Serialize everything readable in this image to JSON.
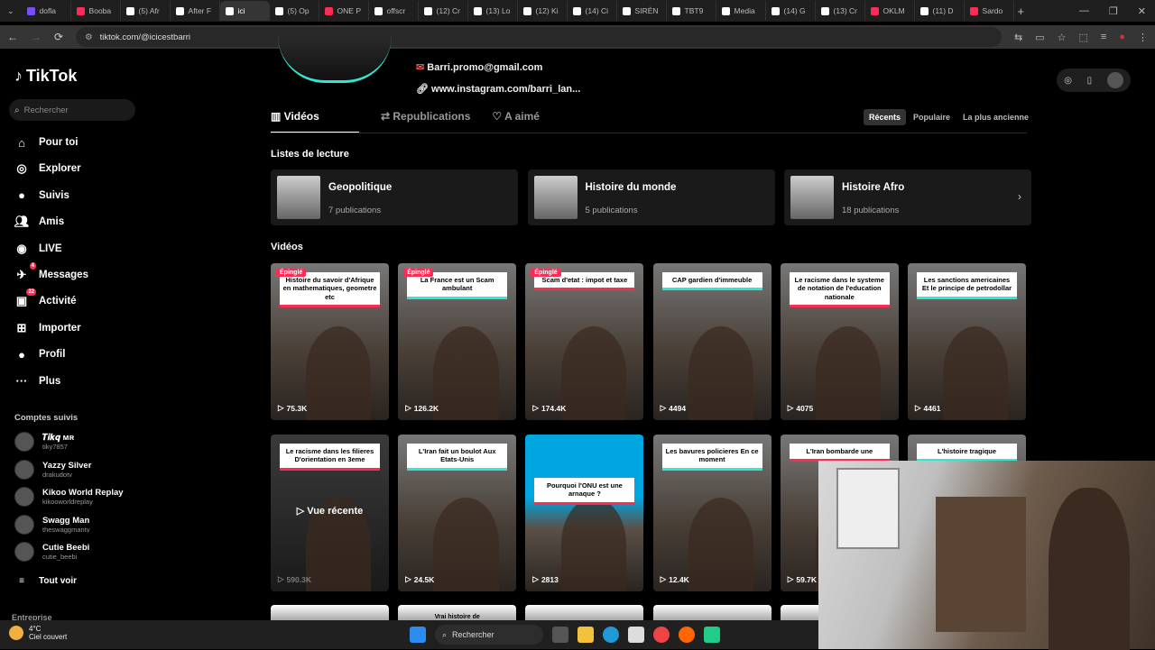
{
  "browser": {
    "tabs": [
      {
        "label": "dofla",
        "color": "#7a4cff"
      },
      {
        "label": "Booba",
        "color": "#fe2c55"
      },
      {
        "label": "(5) Afr",
        "color": "#ffffff"
      },
      {
        "label": "After F",
        "color": "#ffffff"
      },
      {
        "label": "ici",
        "color": "#ffffff",
        "active": true
      },
      {
        "label": "(5) Op",
        "color": "#ffffff"
      },
      {
        "label": "ONE P",
        "color": "#fe2c55"
      },
      {
        "label": "offscr",
        "color": "#ffffff"
      },
      {
        "label": "(12) Cr",
        "color": "#ffffff"
      },
      {
        "label": "(13) Lo",
        "color": "#ffffff"
      },
      {
        "label": "(12) Ki",
        "color": "#ffffff"
      },
      {
        "label": "(14) Ci",
        "color": "#ffffff"
      },
      {
        "label": "SIRÈN",
        "color": "#ffffff"
      },
      {
        "label": "TBT9",
        "color": "#ffffff"
      },
      {
        "label": "Media",
        "color": "#ffffff"
      },
      {
        "label": "(14) G",
        "color": "#ffffff"
      },
      {
        "label": "(13) Cr",
        "color": "#ffffff"
      },
      {
        "label": "OKLM",
        "color": "#fe2c55"
      },
      {
        "label": "(11) D",
        "color": "#ffffff"
      },
      {
        "label": "Sardo",
        "color": "#fe2c55"
      }
    ],
    "new_tab": "+",
    "url": "tiktok.com/@icicestbarri"
  },
  "sidebar": {
    "logo": "TikTok",
    "search_placeholder": "Rechercher",
    "nav": [
      {
        "label": "Pour toi",
        "icon": "home-icon"
      },
      {
        "label": "Explorer",
        "icon": "compass-icon"
      },
      {
        "label": "Suivis",
        "icon": "following-icon"
      },
      {
        "label": "Amis",
        "icon": "friends-icon"
      },
      {
        "label": "LIVE",
        "icon": "live-icon"
      },
      {
        "label": "Messages",
        "icon": "messages-icon",
        "badge": "4"
      },
      {
        "label": "Activité",
        "icon": "activity-icon",
        "badge": "32"
      },
      {
        "label": "Importer",
        "icon": "upload-icon"
      },
      {
        "label": "Profil",
        "icon": "profile-icon"
      },
      {
        "label": "Plus",
        "icon": "more-icon"
      }
    ],
    "following_title": "Comptes suivis",
    "following": [
      {
        "name": "𝑻𝒊𝒌𝒒 ᴍʀ",
        "handle": "tiky7857"
      },
      {
        "name": "Yazzy Silver",
        "handle": "drakudotv"
      },
      {
        "name": "Kikoo World Replay",
        "handle": "kikooworldreplay"
      },
      {
        "name": "Swagg Man",
        "handle": "theswaggmantv"
      },
      {
        "name": "Cutie Beebi",
        "handle": "cutie_beebi"
      }
    ],
    "see_all": "Tout voir",
    "entreprise": "Entreprise"
  },
  "profile": {
    "email": "Barri.promo@gmail.com",
    "instagram": "www.instagram.com/barri_lan...",
    "tabs": [
      "Vidéos",
      "Republications",
      "A aimé"
    ],
    "sort": [
      "Récents",
      "Populaire",
      "La plus ancienne"
    ],
    "lists_title": "Listes de lecture",
    "lists": [
      {
        "title": "Geopolitique",
        "count": "7 publications"
      },
      {
        "title": "Histoire du monde",
        "count": "5 publications"
      },
      {
        "title": "Histoire Afro",
        "count": "18 publications"
      }
    ],
    "videos_title": "Vidéos",
    "pinned_label": "Épinglé",
    "recent_label": "Vue récente",
    "videos": [
      {
        "caption": "Histoire du savoir d'Afrique en mathematiques, geometre etc",
        "views": "75.3K",
        "pinned": true
      },
      {
        "caption": "La France est un Scam ambulant",
        "views": "126.2K",
        "pinned": true
      },
      {
        "caption": "Scam d'etat : impot et taxe",
        "views": "174.4K",
        "pinned": true
      },
      {
        "caption": "CAP gardien d'immeuble",
        "views": "4494"
      },
      {
        "caption": "Le racisme dans le systeme de notation de l'education nationale",
        "views": "4075"
      },
      {
        "caption": "Les sanctions americaines Et le principe de petrodollar",
        "views": "4461"
      },
      {
        "caption": "Le racisme dans les filieres D'orientation en 3eme",
        "views": "590.3K",
        "recent": true
      },
      {
        "caption": "L'Iran fait un boulot Aux Etats-Unis",
        "views": "24.5K"
      },
      {
        "caption": "Pourquoi l'ONU est une arnaque ?",
        "views": "2813"
      },
      {
        "caption": "Les bavures policieres En ce moment",
        "views": "12.4K"
      },
      {
        "caption": "L'Iran bombarde une",
        "views": "59.7K"
      },
      {
        "caption": "L'histoire tragique",
        "views": ""
      }
    ],
    "row3_partial": [
      "",
      "Vrai histoire de",
      "",
      "",
      ""
    ]
  },
  "taskbar": {
    "temp": "4°C",
    "weather": "Ciel couvert",
    "search": "Rechercher"
  }
}
